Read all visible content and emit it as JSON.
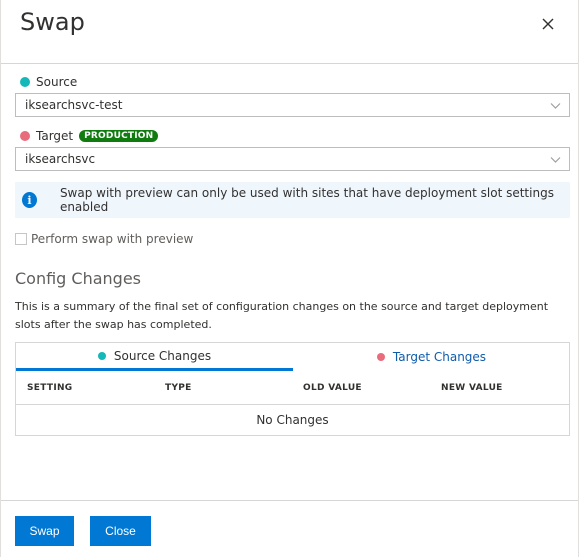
{
  "dialog": {
    "title": "Swap",
    "close_icon": "close-icon"
  },
  "source": {
    "label": "Source",
    "dot_color": "#14b8b8",
    "value": "iksearchsvc-test"
  },
  "target": {
    "label": "Target",
    "dot_color": "#e86c7c",
    "badge": "PRODUCTION",
    "badge_color": "#107c10",
    "value": "iksearchsvc"
  },
  "info": {
    "icon": "info-icon",
    "text": "Swap with preview can only be used with sites that have deployment slot settings enabled"
  },
  "preview": {
    "label": "Perform swap with preview",
    "checked": false
  },
  "config": {
    "title": "Config Changes",
    "summary": "This is a summary of the final set of configuration changes on the source and target deployment slots after the swap has completed.",
    "tabs": [
      {
        "label": "Source Changes",
        "active": true
      },
      {
        "label": "Target Changes",
        "active": false
      }
    ],
    "columns": [
      "SETTING",
      "TYPE",
      "OLD VALUE",
      "NEW VALUE"
    ],
    "empty_text": "No Changes"
  },
  "footer": {
    "swap_label": "Swap",
    "close_label": "Close"
  },
  "colors": {
    "accent": "#0078d4",
    "link": "#0f5cac"
  }
}
